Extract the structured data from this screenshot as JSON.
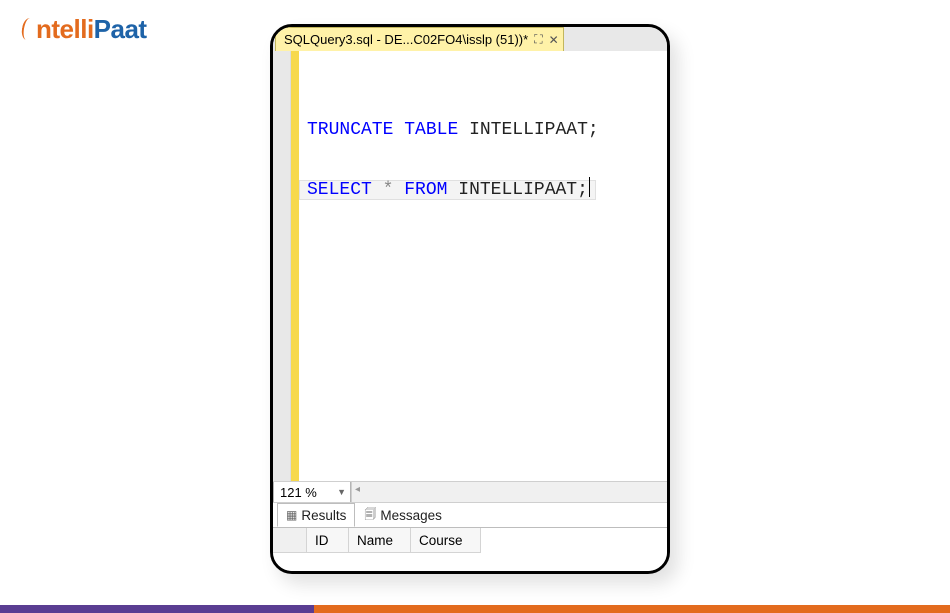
{
  "logo": {
    "part1": "ntelli",
    "part2": "Paat"
  },
  "tab": {
    "title": "SQLQuery3.sql - DE...C02FO4\\isslp (51))*"
  },
  "code": {
    "line1_kw1": "TRUNCATE",
    "line1_kw2": "TABLE",
    "line1_ident": "INTELLIPAAT",
    "line1_end": ";",
    "line2_kw1": "SELECT",
    "line2_op": "*",
    "line2_kw2": "FROM",
    "line2_ident": "INTELLIPAAT",
    "line2_end": ";"
  },
  "zoom": {
    "value": "121 %"
  },
  "results_tabs": {
    "results": "Results",
    "messages": "Messages"
  },
  "grid": {
    "columns": [
      "ID",
      "Name",
      "Course"
    ]
  }
}
